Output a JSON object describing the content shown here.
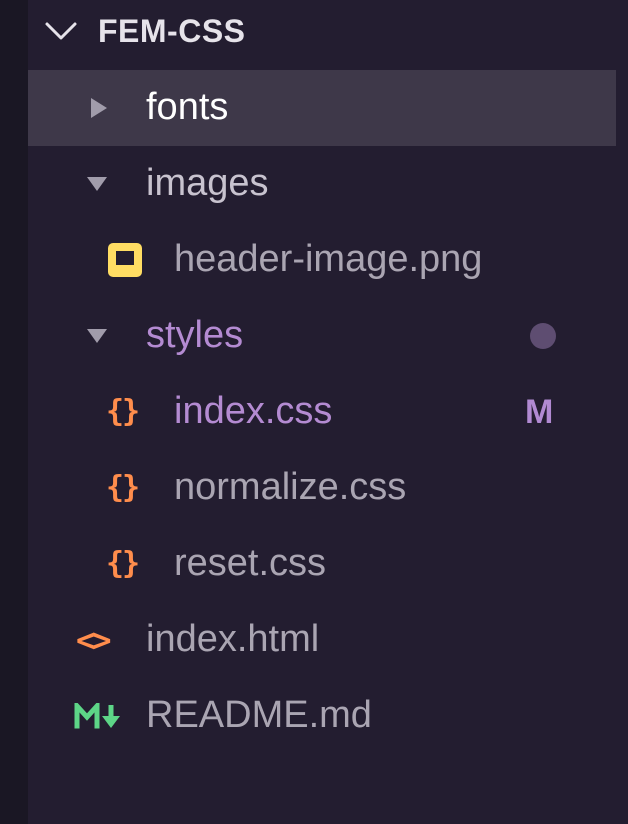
{
  "colors": {
    "folder_text": "#c8c3cf",
    "file_text": "#aaa5b2",
    "selected_text": "#ffffff",
    "modified_text": "#b48bd2",
    "modified_badge": "#b18ad2",
    "dot_badge": "#5e4d71",
    "twistie": "#a19cab",
    "css_icon": "#ff8d4c",
    "html_icon": "#ff8d4c",
    "image_icon": "#ffdd63",
    "markdown_icon": "#5dd587"
  },
  "explorer": {
    "title": "FEM-CSS",
    "items": [
      {
        "label": "fonts",
        "type": "folder",
        "state": "collapsed",
        "selected": true
      },
      {
        "label": "images",
        "type": "folder",
        "state": "expanded"
      },
      {
        "label": "header-image.png",
        "type": "image"
      },
      {
        "label": "styles",
        "type": "folder",
        "state": "expanded",
        "status": "modified-dot"
      },
      {
        "label": "index.css",
        "type": "css",
        "status": "M"
      },
      {
        "label": "normalize.css",
        "type": "css"
      },
      {
        "label": "reset.css",
        "type": "css"
      },
      {
        "label": "index.html",
        "type": "html"
      },
      {
        "label": "README.md",
        "type": "markdown"
      }
    ]
  },
  "icons": {
    "header": "chevron-down-icon",
    "collapsed_folder": "triangle-right-icon",
    "expanded_folder": "triangle-down-icon",
    "image": "image-file-icon",
    "css": "curly-braces-icon",
    "html": "angle-brackets-icon",
    "markdown": "markdown-icon"
  },
  "glyphs": {
    "css": "{}",
    "html": "<>"
  }
}
